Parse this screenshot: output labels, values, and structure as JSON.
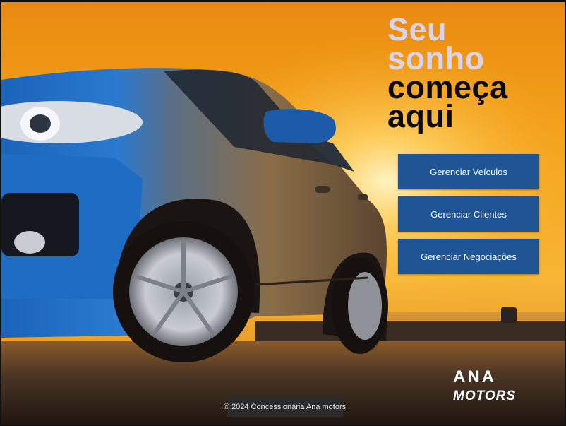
{
  "hero": {
    "headline_line1": "Seu",
    "headline_line2": "sonho",
    "headline_line3": "começa",
    "headline_line4": "aqui"
  },
  "menu": {
    "vehicles_label": "Gerenciar Veículos",
    "clients_label": "Gerenciar Clientes",
    "deals_label": "Gerenciar Negociações"
  },
  "brand": {
    "line1": "ANA",
    "line2": "MOTORS"
  },
  "footer": {
    "text": "© 2024 Concessionária Ana motors"
  },
  "colors": {
    "accent_button": "#1f5595",
    "headline_light": "#d9d4ec",
    "headline_dark": "#0b0b0b",
    "sky_orange": "#f4a21a"
  }
}
